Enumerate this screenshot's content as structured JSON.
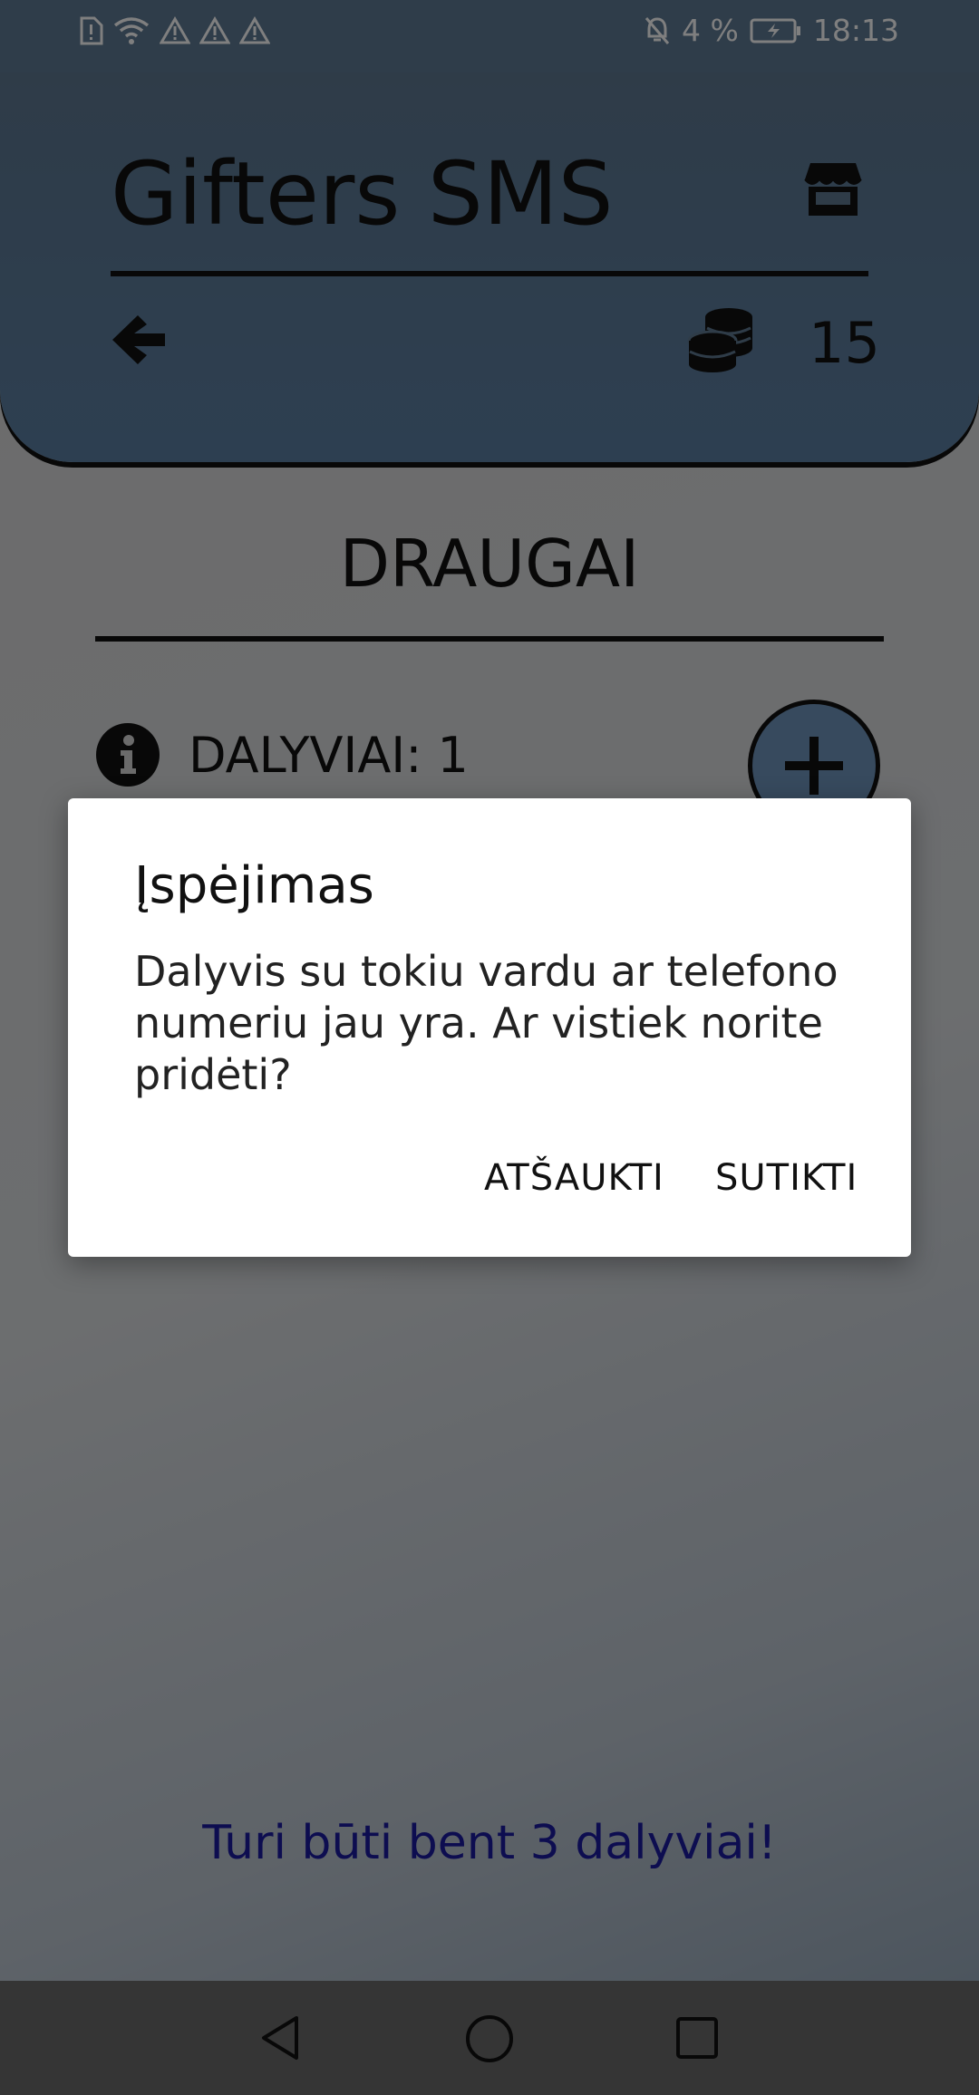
{
  "status_bar": {
    "battery_percent": "4 %",
    "time": "18:13"
  },
  "header": {
    "title": "Gifters SMS",
    "coins": "15"
  },
  "page": {
    "heading": "DRAUGAI",
    "participants_label": "DALYVIAI: 1",
    "min_participants_note": "Turi būti bent 3 dalyviai!"
  },
  "dialog": {
    "title": "Įspėjimas",
    "message": "Dalyvis su tokiu vardu ar telefono numeriu jau yra. Ar vistiek norite pridėti?",
    "cancel_label": "ATŠAUKTI",
    "confirm_label": "SUTIKTI"
  },
  "colors": {
    "header_bg": "#5b7fa3",
    "note_text": "#1b1ba0",
    "add_button_bg": "#6f94bd"
  },
  "icons": {
    "store": "store-icon",
    "back": "arrow-left-icon",
    "coins": "coins-icon",
    "info": "info-icon",
    "add": "plus-icon"
  }
}
